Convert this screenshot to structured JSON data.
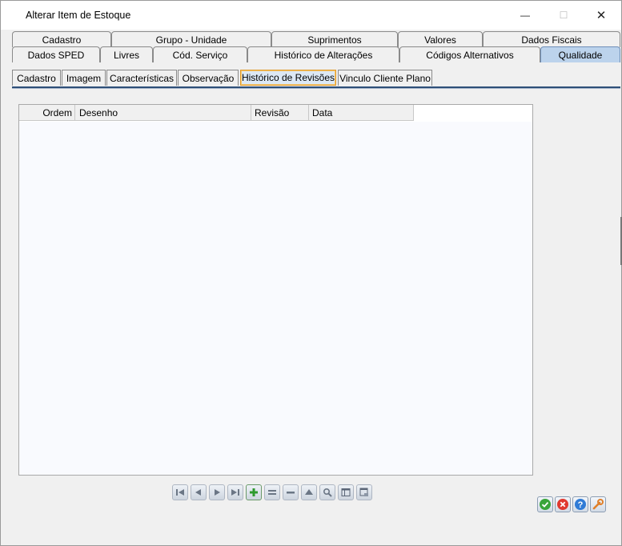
{
  "window": {
    "title": "Alterar Item de Estoque",
    "minimize_glyph": "—",
    "maximize_glyph": "☐",
    "close_glyph": "✕"
  },
  "main_tabs": {
    "row1": [
      "Cadastro",
      "Grupo - Unidade",
      "Suprimentos",
      "Valores",
      "Dados Fiscais"
    ],
    "row2": [
      "Dados SPED",
      "Livres",
      "Cód. Serviço",
      "Histórico de Alterações",
      "Códigos Alternativos",
      "Qualidade"
    ],
    "active": "Qualidade"
  },
  "sub_tabs": {
    "items": [
      "Cadastro",
      "Imagem",
      "Características",
      "Observação",
      "Histórico de Revisões",
      "Vinculo Cliente Plano"
    ],
    "active": "Histórico de Revisões"
  },
  "grid": {
    "columns": [
      "Ordem",
      "Desenho",
      "Revisão",
      "Data"
    ],
    "rows": []
  },
  "navigator": {
    "buttons": [
      "first-icon",
      "prior-icon",
      "next-icon",
      "last-icon",
      "insert-icon",
      "edit-icon",
      "delete-icon",
      "post-icon",
      "search-icon",
      "grid-icon",
      "refresh-icon"
    ]
  },
  "actions": {
    "buttons": [
      "confirm-icon",
      "cancel-icon",
      "help-icon",
      "tools-icon"
    ],
    "colors": {
      "confirm": "#3aa53a",
      "cancel": "#e0392f",
      "help": "#2f7bd6",
      "tools": "#e0802a"
    }
  },
  "colors": {
    "active_tab": "#bcd3ec",
    "active_subtab_border": "#e09a2a",
    "separator": "#2e4f78"
  }
}
